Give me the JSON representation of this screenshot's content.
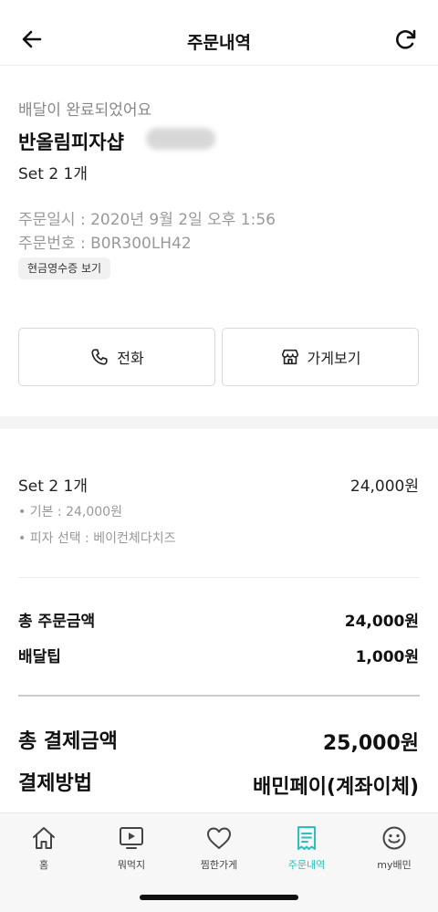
{
  "header": {
    "title": "주문내역"
  },
  "order": {
    "status": "배달이 완료되었어요",
    "store_name": "반올림피자샵",
    "menu_summary": "Set 2 1개",
    "order_date": "주문일시 : 2020년 9월 2일 오후 1:56",
    "order_number": "주문번호 : B0R300LH42",
    "receipt_button": "현금영수증 보기"
  },
  "actions": {
    "call_label": "전화",
    "store_label": "가게보기"
  },
  "details": {
    "item": {
      "name": "Set 2 1개",
      "price": "24,000원"
    },
    "options": [
      "• 기본 : 24,000원",
      "• 피자 선택 : 베이컨체다치즈"
    ],
    "total_order_label": "총 주문금액",
    "total_order_value": "24,000원",
    "delivery_tip_label": "배달팁",
    "delivery_tip_value": "1,000원",
    "total_payment_label": "총 결제금액",
    "total_payment_value": "25,000원",
    "payment_method_label": "결제방법",
    "payment_method_value": "배민페이(계좌이체)"
  },
  "tabbar": {
    "tabs": [
      {
        "label": "홈",
        "icon": "home-icon"
      },
      {
        "label": "뭐먹지",
        "icon": "play-screen-icon"
      },
      {
        "label": "찜한가게",
        "icon": "heart-icon"
      },
      {
        "label": "주문내역",
        "icon": "order-list-icon"
      },
      {
        "label": "my배민",
        "icon": "smile-icon"
      }
    ],
    "active_color": "#2ac1bc"
  }
}
